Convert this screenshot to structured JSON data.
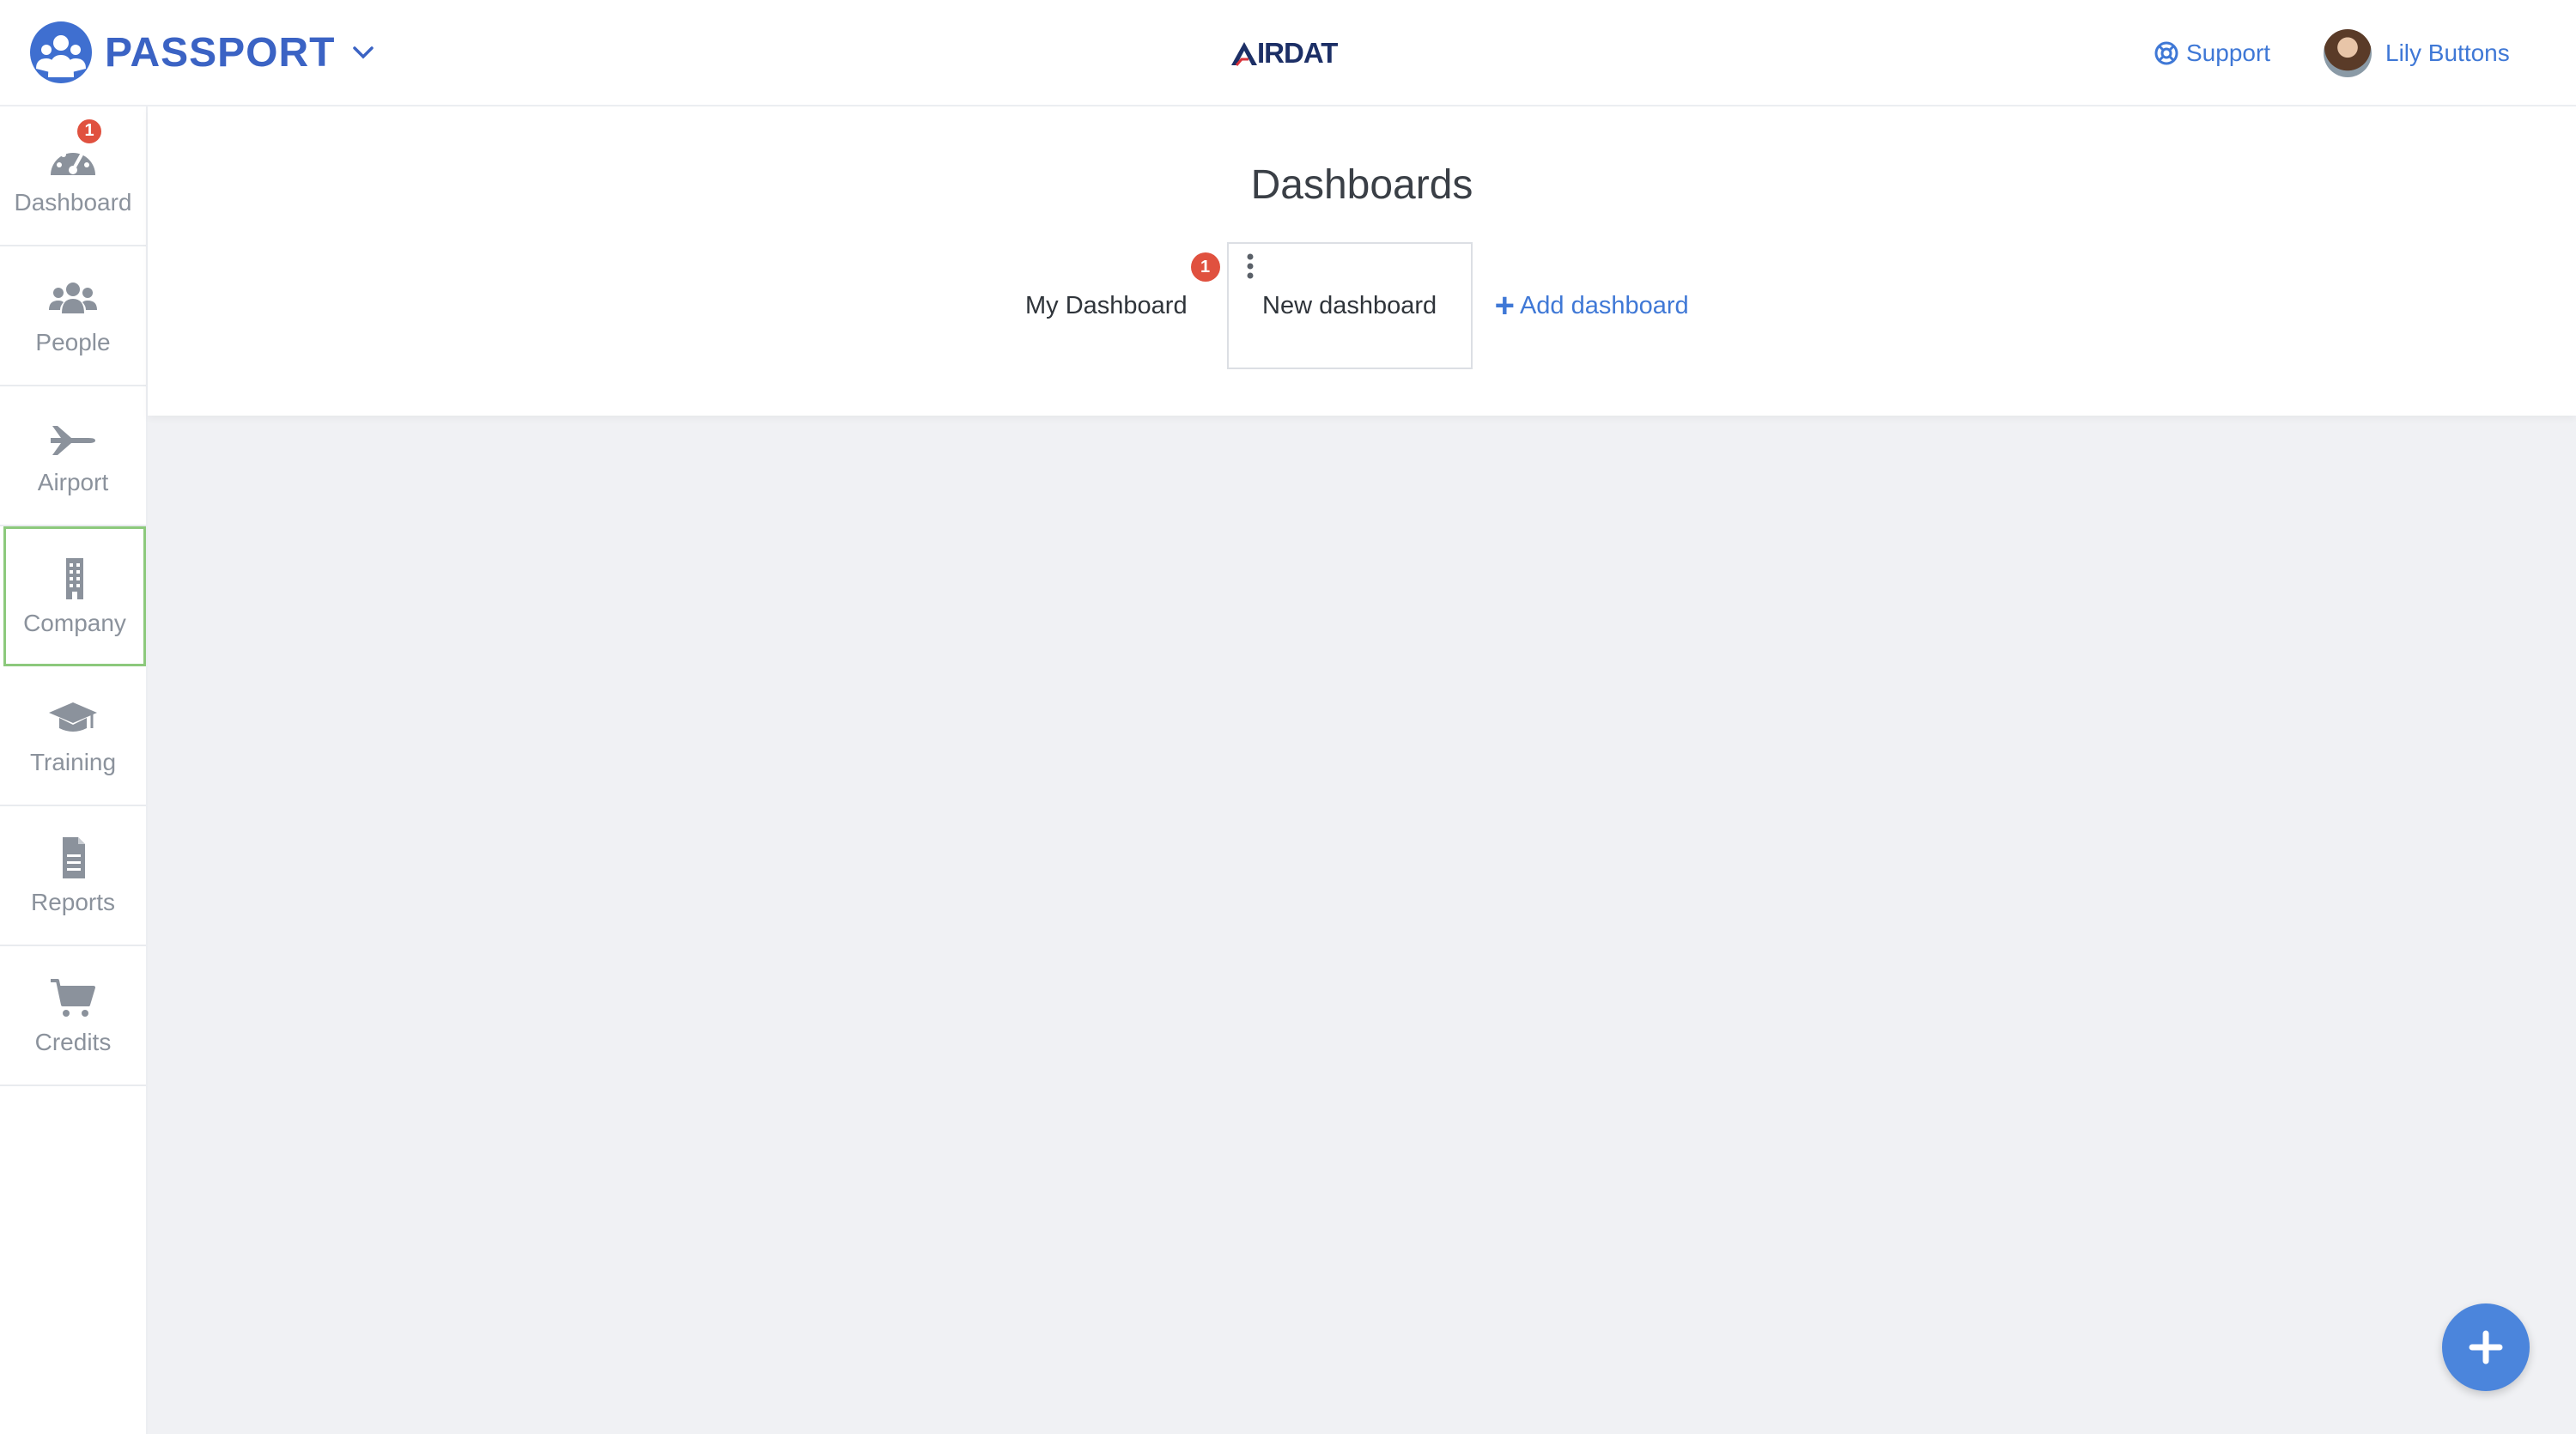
{
  "header": {
    "brand_name": "PASSPORT",
    "brand_icon": "passport-people-icon",
    "airdat_logo_text": "IRDAT",
    "support_label": "Support",
    "user_name": "Lily Buttons"
  },
  "sidebar": {
    "items": [
      {
        "label": "Dashboard",
        "icon": "gauge-icon",
        "badge": "1"
      },
      {
        "label": "People",
        "icon": "users-icon"
      },
      {
        "label": "Airport",
        "icon": "plane-icon"
      },
      {
        "label": "Company",
        "icon": "building-icon",
        "active": true
      },
      {
        "label": "Training",
        "icon": "graduation-cap-icon"
      },
      {
        "label": "Reports",
        "icon": "document-icon"
      },
      {
        "label": "Credits",
        "icon": "cart-icon"
      }
    ]
  },
  "main": {
    "title": "Dashboards",
    "tabs": [
      {
        "label": "My Dashboard",
        "badge": "1"
      },
      {
        "label": "New dashboard",
        "selected": true
      }
    ],
    "add_label": "Add dashboard"
  },
  "colors": {
    "brand": "#3b63c4",
    "link": "#3f78d6",
    "badge": "#e0513f",
    "active_border": "#8cc97c",
    "fab": "#4b85dc",
    "content_bg": "#f0f1f4"
  }
}
